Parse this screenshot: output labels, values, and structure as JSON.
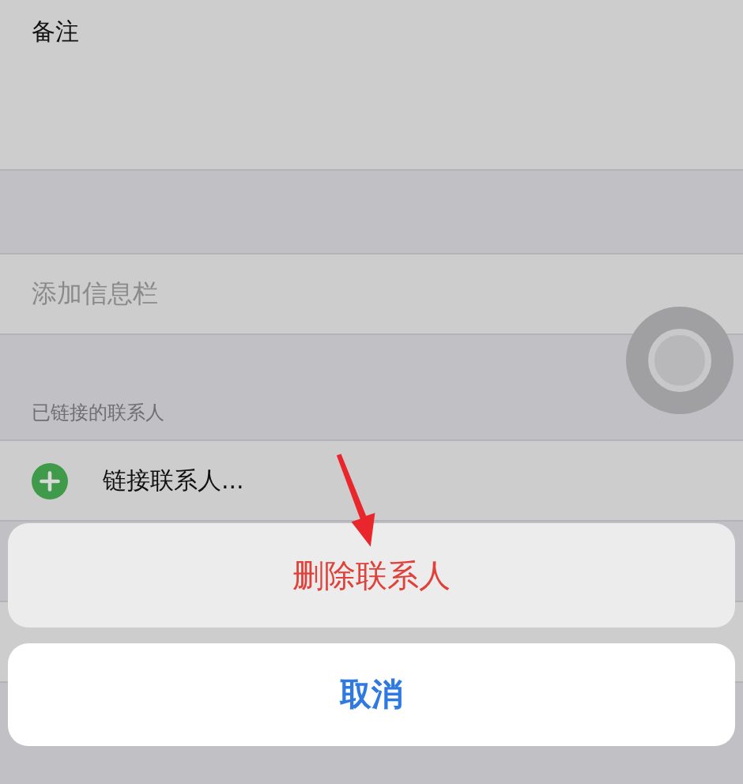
{
  "notes": {
    "label": "备注"
  },
  "add_field": {
    "label": "添加信息栏"
  },
  "linked_section": {
    "header": "已链接的联系人",
    "items": [
      {
        "label": "链接联系人..."
      }
    ]
  },
  "action_sheet": {
    "actions": [
      {
        "label": "删除联系人",
        "kind": "destructive"
      }
    ],
    "cancel": {
      "label": "取消"
    }
  }
}
